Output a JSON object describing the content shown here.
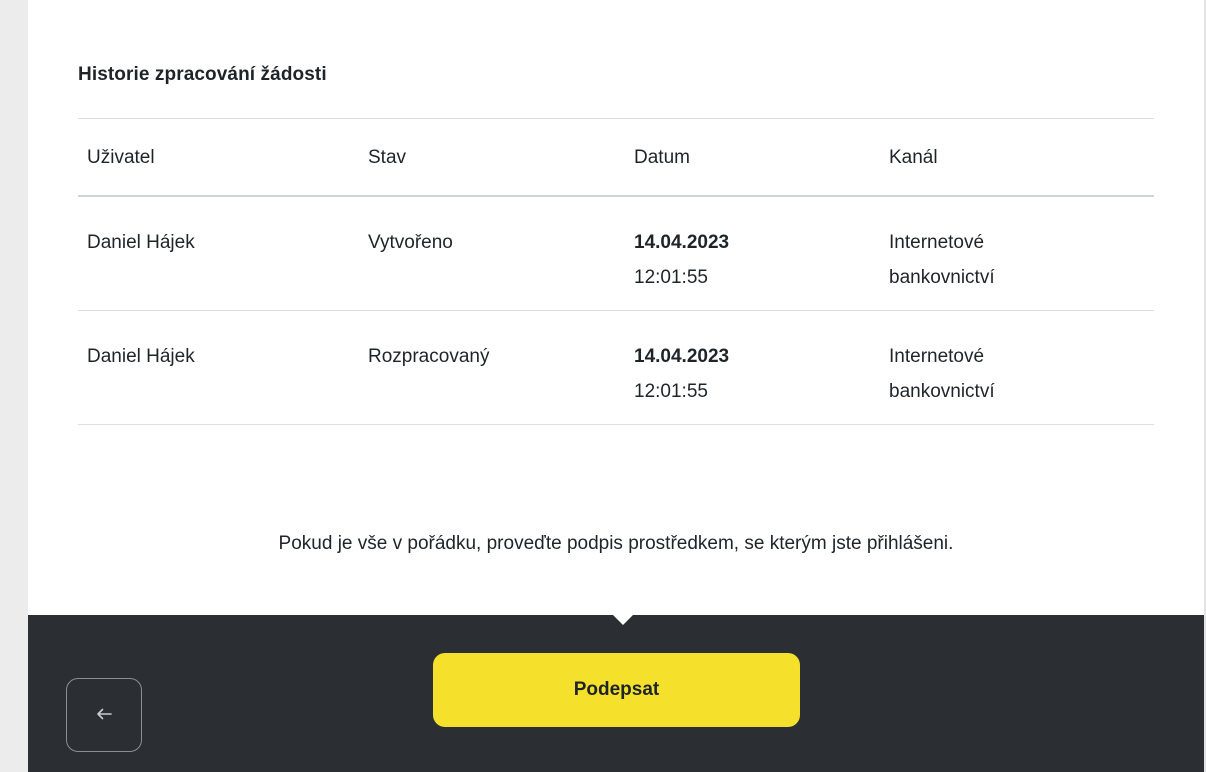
{
  "history": {
    "title": "Historie zpracování žádosti",
    "columns": {
      "user": "Uživatel",
      "status": "Stav",
      "date": "Datum",
      "channel": "Kanál"
    },
    "rows": [
      {
        "user": "Daniel Hájek",
        "status": "Vytvořeno",
        "date": "14.04.2023",
        "time": "12:01:55",
        "channel": "Internetové bankovnictví"
      },
      {
        "user": "Daniel Hájek",
        "status": "Rozpracovaný",
        "date": "14.04.2023",
        "time": "12:01:55",
        "channel": "Internetové bankovnictví"
      }
    ]
  },
  "confirmation": {
    "text": "Pokud je vše v pořádku, proveďte podpis prostředkem, se kterým jste přihlášeni."
  },
  "footer": {
    "sign_label": "Podepsat",
    "back_icon": "arrow-left-icon"
  },
  "colors": {
    "accent": "#f5e12c",
    "footer_bg": "#2b2f33",
    "text": "#1f2429"
  }
}
